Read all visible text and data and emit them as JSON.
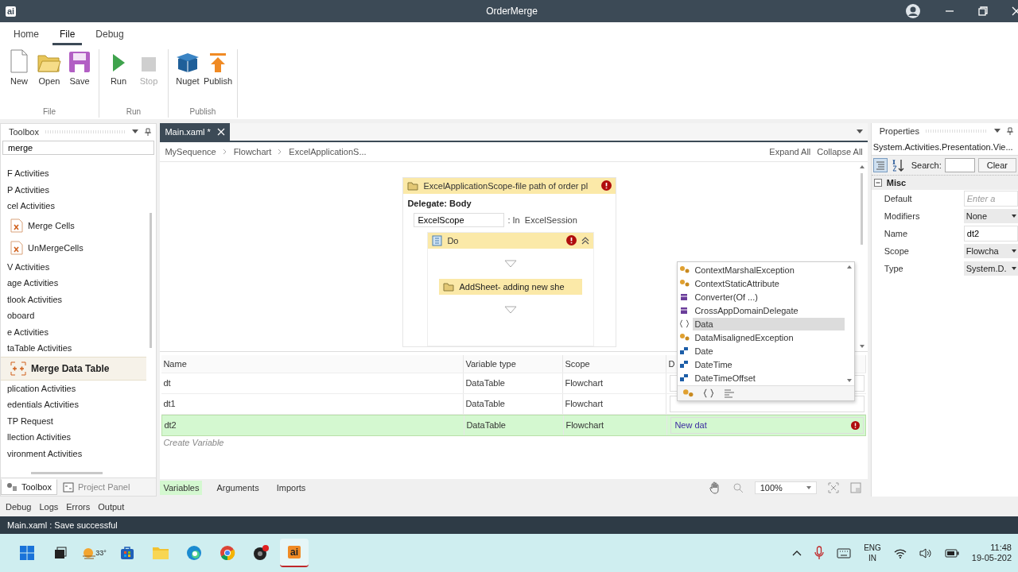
{
  "window": {
    "title": "OrderMerge",
    "logo": "ai"
  },
  "ribbon": {
    "tabs": [
      {
        "label": "Home",
        "selected": false
      },
      {
        "label": "File",
        "selected": true
      },
      {
        "label": "Debug",
        "selected": false
      }
    ],
    "groups": [
      {
        "label": "File",
        "buttons": [
          {
            "label": "New",
            "kind": "new",
            "disabled": false
          },
          {
            "label": "Open",
            "kind": "open",
            "disabled": false
          },
          {
            "label": "Save",
            "kind": "save",
            "disabled": false
          }
        ]
      },
      {
        "label": "Run",
        "buttons": [
          {
            "label": "Run",
            "kind": "run",
            "disabled": false
          },
          {
            "label": "Stop",
            "kind": "stop",
            "disabled": true
          }
        ]
      },
      {
        "label": "Publish",
        "buttons": [
          {
            "label": "Nuget",
            "kind": "nuget",
            "disabled": false
          },
          {
            "label": "Publish",
            "kind": "publish",
            "disabled": false
          }
        ]
      }
    ]
  },
  "toolbox": {
    "title": "Toolbox",
    "search": {
      "value": "merge"
    },
    "items": [
      {
        "label": "F Activities",
        "kind": "category",
        "selected": false
      },
      {
        "label": "P Activities",
        "kind": "category",
        "selected": false
      },
      {
        "label": "cel Activities",
        "kind": "category",
        "selected": false
      },
      {
        "label": "Merge Cells",
        "kind": "excel",
        "selected": false
      },
      {
        "label": "UnMergeCells",
        "kind": "excel",
        "selected": false
      },
      {
        "label": "V Activities",
        "kind": "category",
        "selected": false
      },
      {
        "label": "age Activities",
        "kind": "category",
        "selected": false
      },
      {
        "label": "tlook Activities",
        "kind": "category",
        "selected": false
      },
      {
        "label": "oboard",
        "kind": "category",
        "selected": false
      },
      {
        "label": "e Activities",
        "kind": "category",
        "selected": false
      },
      {
        "label": "taTable Activities",
        "kind": "category",
        "selected": false
      },
      {
        "label": "Merge Data Table",
        "kind": "table",
        "selected": true
      },
      {
        "label": "plication Activities",
        "kind": "category",
        "selected": false
      },
      {
        "label": "edentials Activities",
        "kind": "category",
        "selected": false
      },
      {
        "label": "TP Request",
        "kind": "category",
        "selected": false
      },
      {
        "label": "llection Activities",
        "kind": "category",
        "selected": false
      },
      {
        "label": "vironment Activities",
        "kind": "category",
        "selected": false
      }
    ],
    "tabs": [
      {
        "label": "Toolbox",
        "kind": "toolbox",
        "selected": true
      },
      {
        "label": "Project Panel",
        "kind": "project",
        "selected": false
      }
    ]
  },
  "document_tabs": [
    {
      "label": "Main.xaml *",
      "selected": true
    }
  ],
  "breadcrumb": [
    "MySequence",
    "Flowchart",
    "ExcelApplicationS..."
  ],
  "designer_actions": [
    "Expand All",
    "Collapse All"
  ],
  "canvas": {
    "scope": {
      "title": "ExcelApplicationScope-file path of order pl",
      "error": true,
      "delegate_label": "Delegate: Body",
      "argument": {
        "value": "ExcelScope",
        "direction": ": In",
        "type": "ExcelSession"
      },
      "sequence": {
        "title": "Do",
        "error": true,
        "expanded": true,
        "activities": [
          {
            "title": "AddSheet- adding new she"
          }
        ]
      }
    }
  },
  "variables": {
    "columns": [
      "Name",
      "Variable type",
      "Scope",
      "D"
    ],
    "rows": [
      {
        "name": "dt",
        "type": "DataTable",
        "scope": "Flowchart",
        "selected": false,
        "error": false
      },
      {
        "name": "dt1",
        "type": "DataTable",
        "scope": "Flowchart",
        "selected": false,
        "error": false
      },
      {
        "name": "dt2",
        "type": "DataTable",
        "scope": "Flowchart",
        "selected": true,
        "default": "New dat",
        "error": true
      }
    ],
    "create_placeholder": "Create Variable",
    "tabs": [
      {
        "label": "Variables",
        "selected": true
      },
      {
        "label": "Arguments",
        "selected": false
      },
      {
        "label": "Imports",
        "selected": false
      }
    ],
    "zoom": "100%"
  },
  "autocomplete": {
    "items": [
      {
        "label": "ContextMarshalException",
        "kind": "class",
        "selected": false
      },
      {
        "label": "ContextStaticAttribute",
        "kind": "class",
        "selected": false
      },
      {
        "label": "Converter(Of ...)",
        "kind": "delegate",
        "selected": false
      },
      {
        "label": "CrossAppDomainDelegate",
        "kind": "delegate",
        "selected": false
      },
      {
        "label": "Data",
        "kind": "namespace",
        "selected": true
      },
      {
        "label": "DataMisalignedException",
        "kind": "class",
        "selected": false
      },
      {
        "label": "Date",
        "kind": "structure",
        "selected": false
      },
      {
        "label": "DateTime",
        "kind": "structure",
        "selected": false
      },
      {
        "label": "DateTimeOffset",
        "kind": "structure",
        "selected": false
      }
    ]
  },
  "properties": {
    "title": "Properties",
    "object": "System.Activities.Presentation.Vie...",
    "search_label": "Search:",
    "clear": "Clear",
    "category": {
      "label": "Misc",
      "expanded": true
    },
    "rows": [
      {
        "name": "Default",
        "kind": "text",
        "placeholder": "Enter a"
      },
      {
        "name": "Modifiers",
        "kind": "dropdown",
        "value": "None"
      },
      {
        "name": "Name",
        "kind": "text",
        "value": "dt2"
      },
      {
        "name": "Scope",
        "kind": "dropdown",
        "value": "Flowcha"
      },
      {
        "name": "Type",
        "kind": "dropdown",
        "value": "System.D."
      }
    ]
  },
  "output_tabs": [
    "Debug",
    "Logs",
    "Errors",
    "Output"
  ],
  "status_bar": "Main.xaml : Save successful",
  "taskbar": {
    "apps": [
      {
        "kind": "start",
        "active": false
      },
      {
        "kind": "taskview",
        "active": false
      },
      {
        "kind": "weather",
        "label": "33°",
        "active": false
      },
      {
        "kind": "store",
        "active": false
      },
      {
        "kind": "files",
        "active": false
      },
      {
        "kind": "edge",
        "active": false
      },
      {
        "kind": "chrome",
        "active": false
      },
      {
        "kind": "media",
        "active": false
      },
      {
        "kind": "studio",
        "label": "ai",
        "active": true
      }
    ],
    "language": [
      "ENG",
      "IN"
    ],
    "time": "11:48",
    "date": "19-05-202"
  }
}
